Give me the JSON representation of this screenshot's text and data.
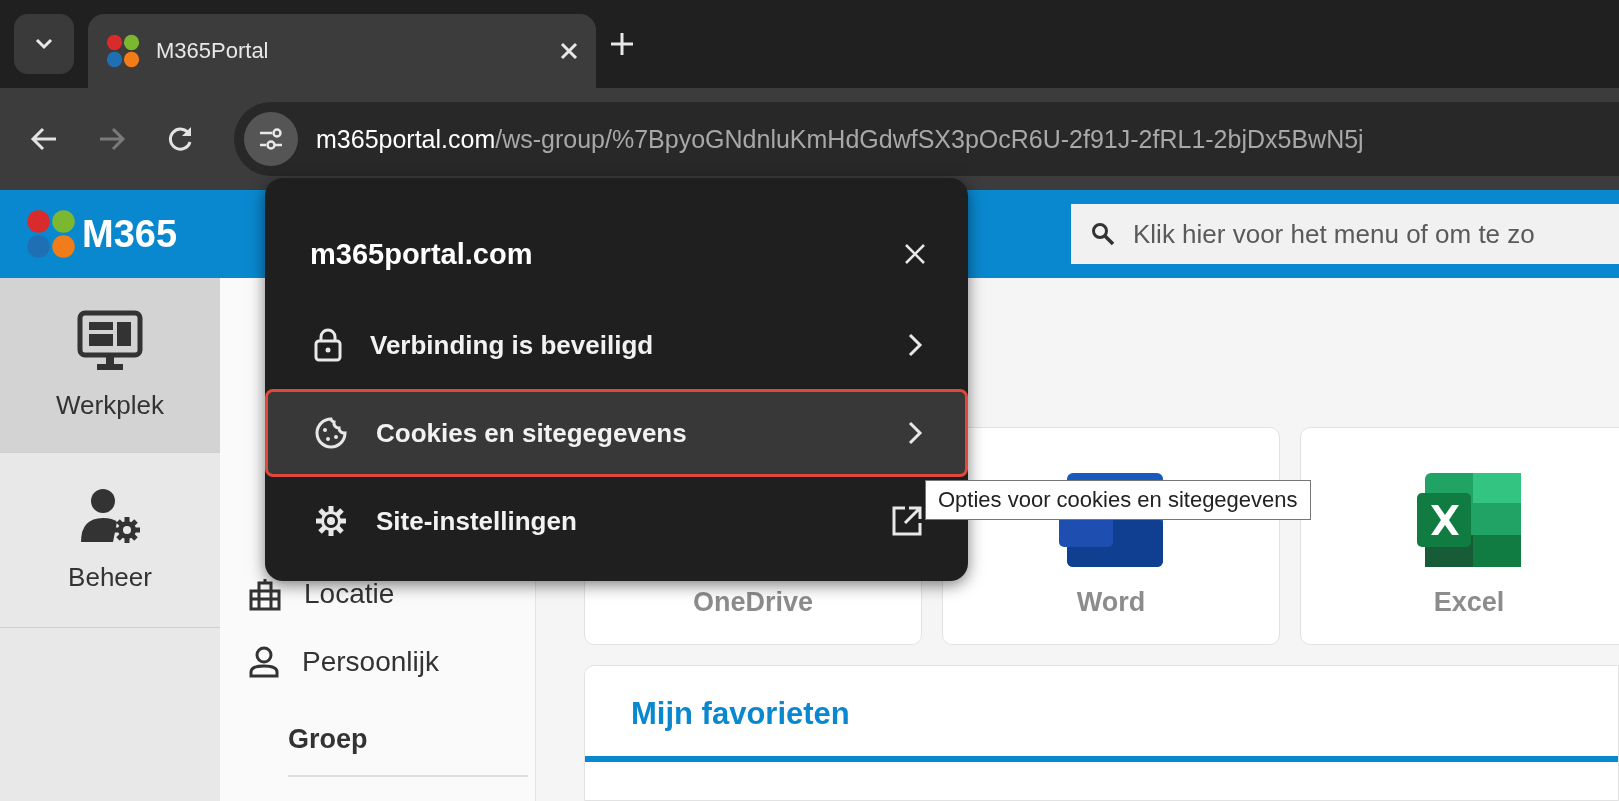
{
  "browser": {
    "tab": {
      "title": "M365Portal"
    },
    "address": {
      "domain": "m365portal.com",
      "path": "/ws-group/%7BpyoGNdnluKmHdGdwfSX3pOcR6U-2f91J-2fRL1-2bjDx5BwN5j"
    }
  },
  "header": {
    "logo": "M365",
    "search": {
      "placeholder": "Klik hier voor het menu of om te zo"
    }
  },
  "rail": [
    {
      "label": "Werkplek",
      "selected": true
    },
    {
      "label": "Beheer",
      "selected": false
    }
  ],
  "nav": {
    "items": [
      {
        "label": "Locatie"
      },
      {
        "label": "Persoonlijk"
      }
    ],
    "section": "Groep"
  },
  "tiles": [
    {
      "label": "OneDrive"
    },
    {
      "label": "Word"
    },
    {
      "label": "Excel"
    }
  ],
  "favorites": {
    "title": "Mijn favorieten"
  },
  "site_popup": {
    "title": "m365portal.com",
    "items": [
      {
        "label": "Verbinding is beveiligd",
        "kind": "chevron",
        "selected": false
      },
      {
        "label": "Cookies en sitegegevens",
        "kind": "chevron",
        "selected": true
      },
      {
        "label": "Site-instellingen",
        "kind": "external",
        "selected": false
      }
    ]
  },
  "tooltip": "Opties voor cookies en sitegegevens"
}
